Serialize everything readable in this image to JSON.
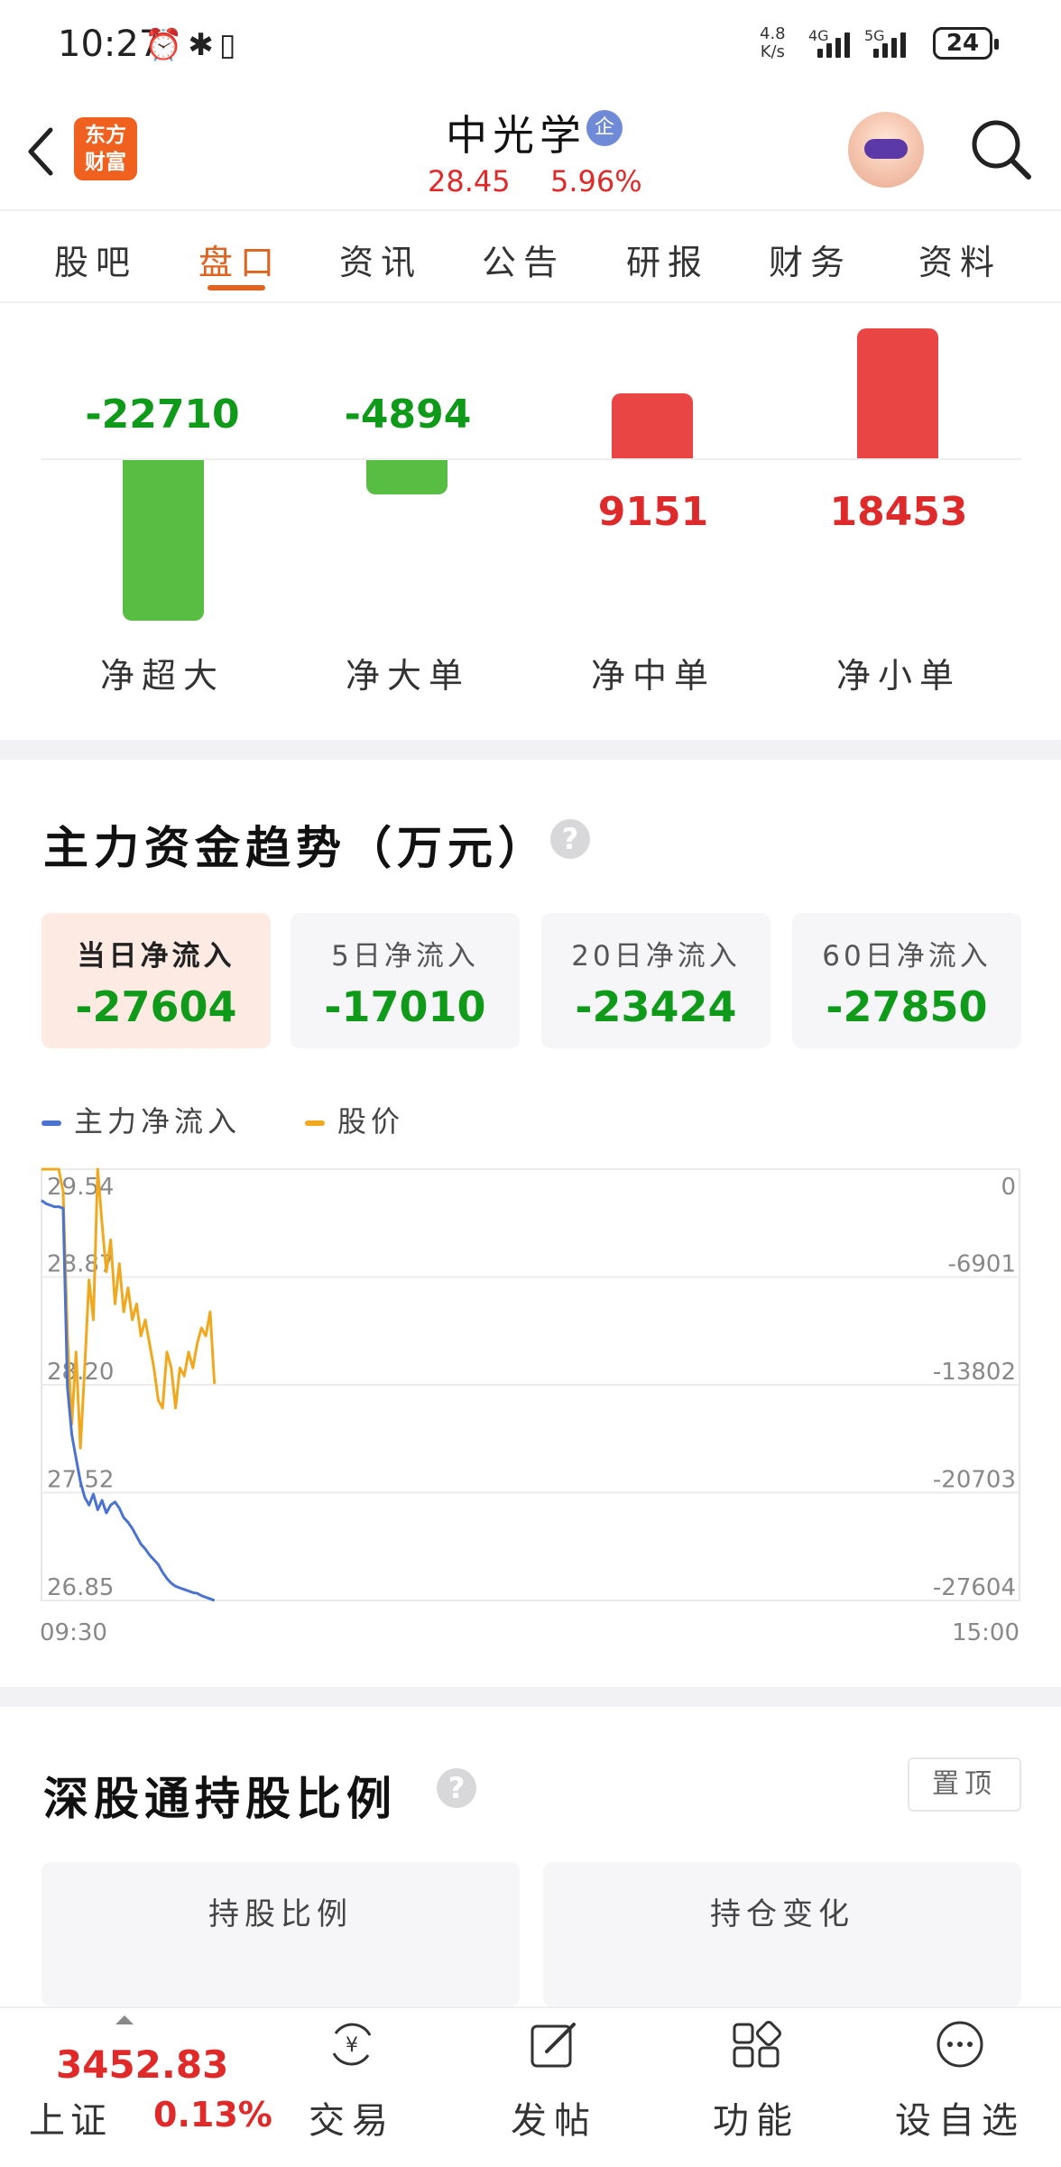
{
  "status_bar": {
    "time": "10:27",
    "speed_value": "4.8",
    "speed_unit": "K/s",
    "net_4g": "4G",
    "net_5g": "5G",
    "battery": "24"
  },
  "header": {
    "logo_line1": "东方",
    "logo_line2": "财富",
    "stock_name": "中光学",
    "badge": "企",
    "price": "28.45",
    "change_pct": "5.96%"
  },
  "tabs": [
    "股吧",
    "盘口",
    "资讯",
    "公告",
    "研报",
    "财务",
    "资料"
  ],
  "active_tab": "盘口",
  "flow": {
    "items": [
      {
        "label": "净超大",
        "value": "-22710"
      },
      {
        "label": "净大单",
        "value": "-4894"
      },
      {
        "label": "净中单",
        "value": "9151"
      },
      {
        "label": "净小单",
        "value": "18453"
      }
    ]
  },
  "trend": {
    "title": "主力资金趋势（万元）",
    "cards": [
      {
        "label": "当日净流入",
        "value": "-27604"
      },
      {
        "label": "5日净流入",
        "value": "-17010"
      },
      {
        "label": "20日净流入",
        "value": "-23424"
      },
      {
        "label": "60日净流入",
        "value": "-27850"
      }
    ],
    "legend_flow": "主力净流入",
    "legend_price": "股价",
    "colors": {
      "flow": "#4a72d0",
      "price": "#f0a91e"
    }
  },
  "chart_data": {
    "type": "line",
    "x_start": "09:30",
    "x_end": "15:00",
    "left_ticks": [
      "29.54",
      "28.87",
      "28.20",
      "27.52",
      "26.85"
    ],
    "right_ticks": [
      "0",
      "-6901",
      "-13802",
      "-20703",
      "-27604"
    ],
    "ylim_price": [
      26.85,
      29.54
    ],
    "ylim_flow": [
      -27604,
      0
    ],
    "series": [
      {
        "name": "主力净流入",
        "color": "#4a72d0",
        "values": [
          -2000,
          -2200,
          -2300,
          -2400,
          -2400,
          -2500,
          -14000,
          -17000,
          -18500,
          -20000,
          -21000,
          -21500,
          -20800,
          -21800,
          -21200,
          -22000,
          -21500,
          -21300,
          -21700,
          -22300,
          -22600,
          -23000,
          -23500,
          -24000,
          -24300,
          -24700,
          -25000,
          -25300,
          -25800,
          -26200,
          -26500,
          -26700,
          -26800,
          -26900,
          -27000,
          -27100,
          -27150,
          -27300,
          -27400,
          -27500,
          -27604
        ]
      },
      {
        "name": "股价",
        "color": "#f0a91e",
        "values": [
          29.54,
          29.54,
          29.54,
          29.54,
          29.54,
          29.4,
          28.5,
          27.95,
          28.4,
          27.8,
          28.3,
          28.85,
          28.6,
          29.54,
          29.2,
          28.9,
          29.1,
          28.7,
          28.95,
          28.65,
          28.8,
          28.6,
          28.7,
          28.5,
          28.6,
          28.45,
          28.3,
          28.1,
          28.05,
          28.4,
          28.3,
          28.05,
          28.3,
          28.25,
          28.4,
          28.3,
          28.45,
          28.55,
          28.5,
          28.65,
          28.2
        ]
      }
    ]
  },
  "holding": {
    "title": "深股通持股比例",
    "pin_label": "置顶",
    "sub_left": "持股比例",
    "sub_right": "持仓变化"
  },
  "bottom_bar": {
    "index_value": "3452.83",
    "index_name": "上证",
    "index_pct": "0.13%",
    "buttons": [
      "交易",
      "发帖",
      "功能",
      "设自选"
    ]
  }
}
